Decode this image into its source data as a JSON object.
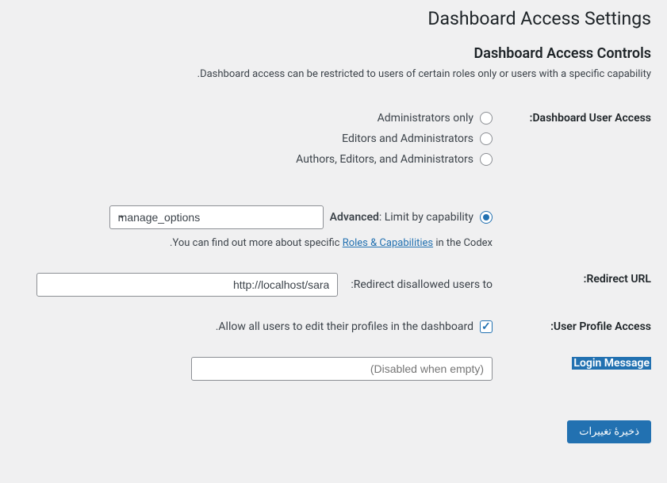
{
  "page_title": "Dashboard Access Settings",
  "section_title": "Dashboard Access Controls",
  "section_desc": "Dashboard access can be restricted to users of certain roles only or users with a specific capability.",
  "rows": {
    "user_access": {
      "label": "Dashboard User Access:",
      "options": [
        "Administrators only",
        "Editors and Administrators",
        "Authors, Editors, and Administrators"
      ],
      "advanced_prefix": "Advanced",
      "advanced_suffix": ": Limit by capability",
      "capability_value": "manage_options",
      "help_before": "You can find out more about specific ",
      "help_link": "Roles & Capabilities",
      "help_after": " in the Codex."
    },
    "redirect": {
      "label": "Redirect URL:",
      "field_label": "Redirect disallowed users to:",
      "value": "http://localhost/sara"
    },
    "profile": {
      "label": "User Profile Access:",
      "checkbox_label": "Allow all users to edit their profiles in the dashboard."
    },
    "login": {
      "label": "Login Message",
      "placeholder": "(Disabled when empty)"
    }
  },
  "submit_label": "ذخیرهٔ تغییرات"
}
